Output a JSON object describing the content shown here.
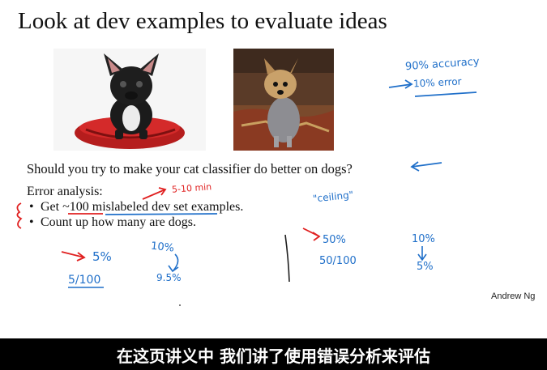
{
  "slide": {
    "title": "Look at dev examples to evaluate ideas",
    "question": "Should you try to make your cat classifier do better on dogs?",
    "error_analysis_title": "Error analysis:",
    "bullets": [
      {
        "prefix": "Get ",
        "highlight": "~100",
        "underlined": "mislabeled dev set",
        "suffix": " examples."
      },
      {
        "text": "Count up how many are dogs."
      }
    ],
    "bullet_symbol": "•",
    "author": "Andrew Ng"
  },
  "annotations": {
    "accuracy": "90% accuracy",
    "error": "10% error",
    "time": "5-10 min",
    "ceiling": "\"ceiling\"",
    "left_pct": "5%",
    "left_ratio": "5/100",
    "left_from": "10%",
    "left_to": "9.5%",
    "right_pct": "50%",
    "right_ratio": "50/100",
    "right_from": "10%",
    "right_to": "5%"
  },
  "colors": {
    "ink_blue": "#1f6fc9",
    "ink_red": "#e02020",
    "subtitle_bar": "#000000"
  },
  "subtitle": "在这页讲义中 我们讲了使用错误分析来评估"
}
